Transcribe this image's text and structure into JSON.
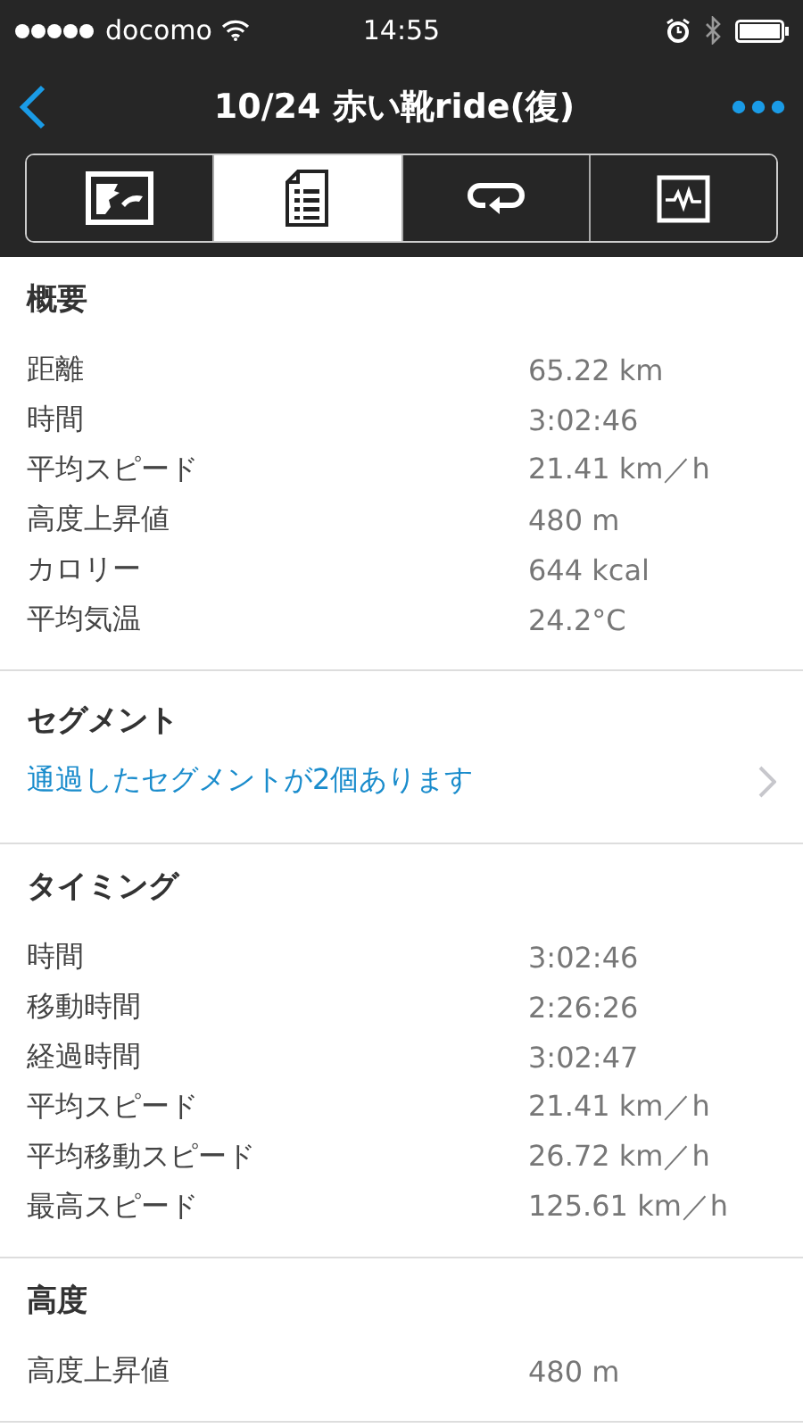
{
  "status_bar": {
    "carrier": "docomo",
    "time": "14:55"
  },
  "nav": {
    "title": "10/24  赤い靴ride(復)"
  },
  "tabs": [
    {
      "kind": "map",
      "selected": false
    },
    {
      "kind": "list",
      "selected": true
    },
    {
      "kind": "laps",
      "selected": false
    },
    {
      "kind": "chart",
      "selected": false
    }
  ],
  "sections": [
    {
      "kind": "stats",
      "title": "概要",
      "rows": [
        {
          "label": "距離",
          "value": "65.22 km"
        },
        {
          "label": "時間",
          "value": "3:02:46"
        },
        {
          "label": "平均スピード",
          "value": "21.41 km／h"
        },
        {
          "label": "高度上昇値",
          "value": "480 m"
        },
        {
          "label": "カロリー",
          "value": "644 kcal"
        },
        {
          "label": "平均気温",
          "value": "24.2°C"
        }
      ]
    },
    {
      "kind": "link",
      "title": "セグメント",
      "link": "通過したセグメントが2個あります"
    },
    {
      "kind": "stats",
      "title": "タイミング",
      "rows": [
        {
          "label": "時間",
          "value": "3:02:46"
        },
        {
          "label": "移動時間",
          "value": "2:26:26"
        },
        {
          "label": "経過時間",
          "value": "3:02:47"
        },
        {
          "label": "平均スピード",
          "value": "21.41 km／h"
        },
        {
          "label": "平均移動スピード",
          "value": "26.72 km／h"
        },
        {
          "label": "最高スピード",
          "value": "125.61 km／h"
        }
      ]
    },
    {
      "kind": "stats",
      "title": "高度",
      "rows": [
        {
          "label": "高度上昇値",
          "value": "480 m"
        }
      ]
    }
  ]
}
